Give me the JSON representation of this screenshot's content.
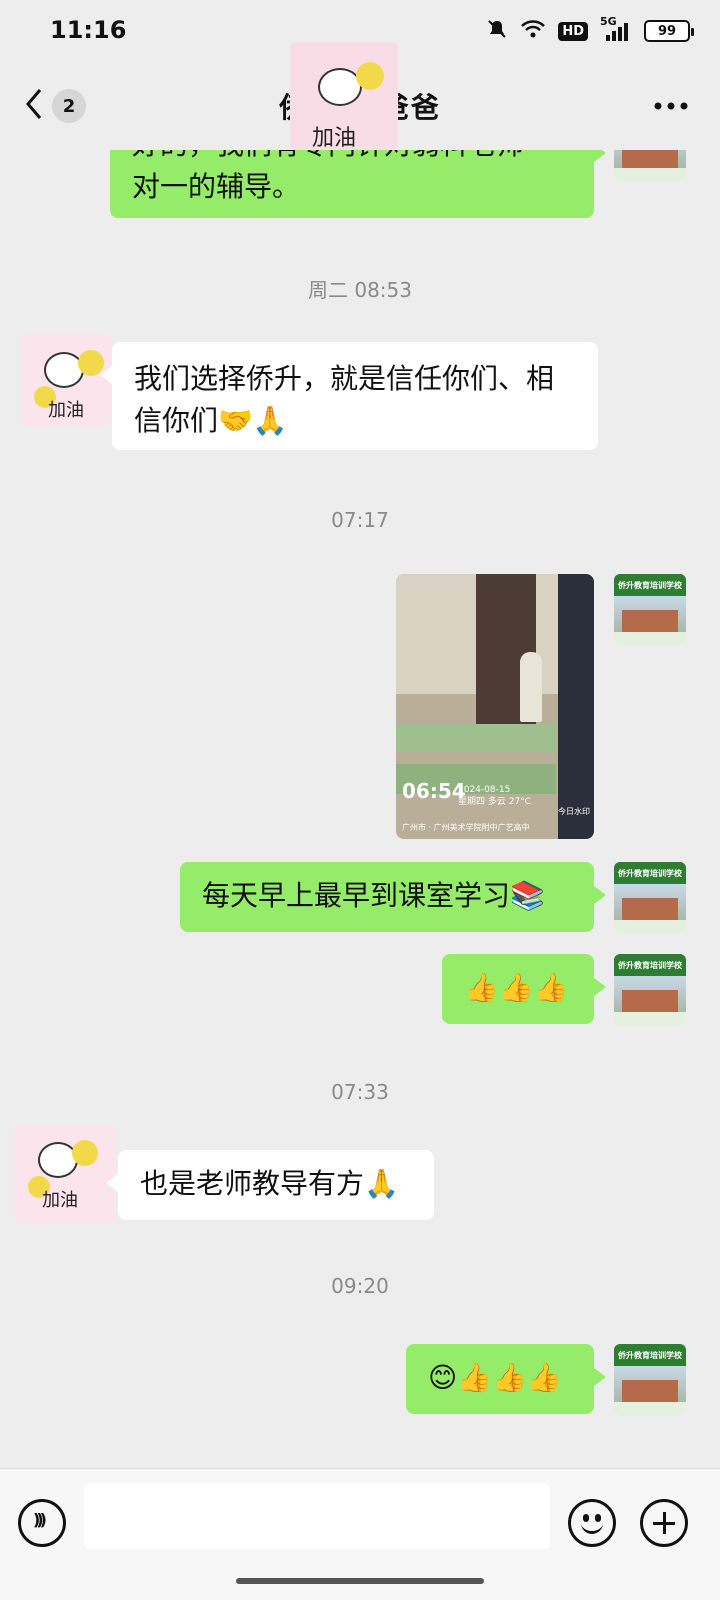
{
  "status_bar": {
    "time": "11:16",
    "network": "5G",
    "hd_label": "HD",
    "battery": "99",
    "icons": [
      "mute-icon",
      "wifi-icon",
      "hd-icon",
      "signal-icon",
      "battery-icon"
    ]
  },
  "navbar": {
    "back_count": "2",
    "title": "侨升     的爸爸",
    "more_icon": "more-icon"
  },
  "messages": [
    {
      "type": "text",
      "direction": "out",
      "text": "好的，我们有专门针对弱科老师一对一的辅导。"
    },
    {
      "type": "timestamp",
      "text": "周二 08:53"
    },
    {
      "type": "text",
      "direction": "in",
      "text": "我们选择侨升，就是信任你们、相信你们🤝🙏"
    },
    {
      "type": "timestamp",
      "text": "07:17"
    },
    {
      "type": "image",
      "direction": "out",
      "overlay_time": "06:54",
      "overlay_date": "2024-08-15",
      "overlay_weather": "星期四 多云 27°C",
      "overlay_watermark": "今日水印",
      "overlay_location": "广州市 · 广州美术学院附中广艺高中"
    },
    {
      "type": "text",
      "direction": "out",
      "text": "每天早上最早到课室学习📚"
    },
    {
      "type": "text",
      "direction": "out",
      "text": "👍👍👍"
    },
    {
      "type": "timestamp",
      "text": "07:33"
    },
    {
      "type": "text",
      "direction": "in",
      "text": "也是老师教导有方🙏"
    },
    {
      "type": "timestamp",
      "text": "09:20"
    },
    {
      "type": "text",
      "direction": "out",
      "text": "😊👍👍👍"
    }
  ],
  "avatars": {
    "school_label": "侨升教育培训学校",
    "user_sticker_text": "加油"
  },
  "input_bar": {
    "placeholder": "",
    "voice_icon": "voice-icon",
    "emoji_icon": "emoji-icon",
    "plus_icon": "plus-icon"
  },
  "colors": {
    "background": "#ededed",
    "outgoing_bubble": "#95ec69",
    "incoming_bubble": "#ffffff",
    "timestamp_text": "#8a8a8a"
  }
}
